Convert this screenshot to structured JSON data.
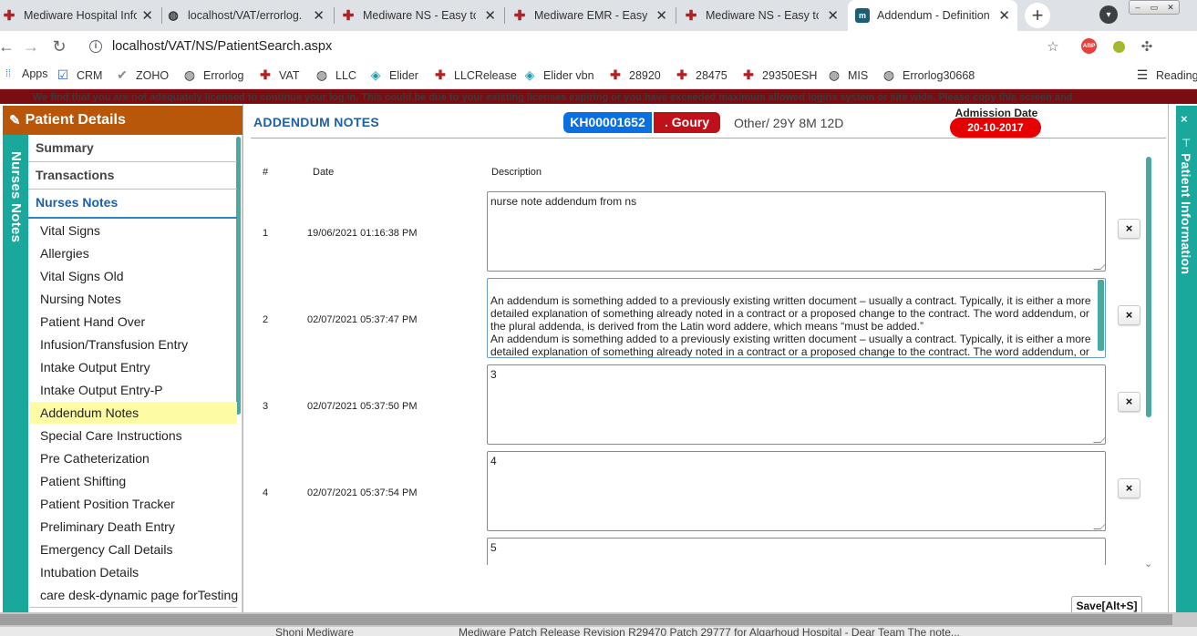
{
  "browser": {
    "tabs": [
      {
        "title": "Mediware Hospital Info",
        "icon": "mediware-cross-icon"
      },
      {
        "title": "localhost/VAT/errorlog.",
        "icon": "globe-icon"
      },
      {
        "title": "Mediware NS - Easy to",
        "icon": "mediware-cross-icon"
      },
      {
        "title": "Mediware EMR - Easy to",
        "icon": "mediware-cross-icon"
      },
      {
        "title": "Mediware NS - Easy to",
        "icon": "mediware-cross-icon"
      },
      {
        "title": "Addendum - Definition",
        "icon": "dictionary-icon",
        "active": true
      }
    ],
    "url": "localhost/VAT/NS/PatientSearch.aspx",
    "bookmarks": [
      {
        "label": "Apps",
        "icon": "apps-grid-icon"
      },
      {
        "label": "CRM",
        "icon": "checkbox-icon"
      },
      {
        "label": "ZOHO",
        "icon": "check-icon"
      },
      {
        "label": "Errorlog",
        "icon": "globe-icon"
      },
      {
        "label": "VAT",
        "icon": "mediware-cross-icon"
      },
      {
        "label": "LLC",
        "icon": "globe-icon"
      },
      {
        "label": "Elider",
        "icon": "diamond-icon"
      },
      {
        "label": "LLCRelease",
        "icon": "mediware-cross-icon"
      },
      {
        "label": "Elider vbn",
        "icon": "diamond-icon"
      },
      {
        "label": "28920",
        "icon": "mediware-cross-icon"
      },
      {
        "label": "28475",
        "icon": "mediware-cross-icon"
      },
      {
        "label": "29350ESH",
        "icon": "mediware-cross-icon"
      },
      {
        "label": "MIS",
        "icon": "globe-icon"
      },
      {
        "label": "Errorlog30668",
        "icon": "globe-icon"
      }
    ],
    "reading_list": "Reading",
    "license_banner": "We find that you are not adequately licensed to continue your log in. This could be due to your existing licenses expiring or you have exceeded maximum allowed logins system or site wide. Please copy this screen and"
  },
  "panel": {
    "header": "Patient Details",
    "rail_label": "Nurses Notes",
    "sections": [
      "Summary",
      "Transactions",
      "Nurses Notes"
    ],
    "active_section": "Nurses Notes",
    "items": [
      "Vital Signs",
      "Allergies",
      "Vital Signs Old",
      "Nursing Notes",
      "Patient Hand Over",
      "Infusion/Transfusion Entry",
      "Intake Output Entry",
      "Intake Output Entry-P",
      "Addendum Notes",
      "Special Care Instructions",
      "Pre Catheterization",
      "Patient Shifting",
      "Patient Position Tracker",
      "Preliminary Death Entry",
      "Emergency Call Details",
      "Intubation Details",
      "care desk-dynamic page forTesting"
    ],
    "selected_item": "Addendum Notes"
  },
  "main": {
    "title": "ADDENDUM NOTES",
    "patient_id": "KH00001652",
    "patient_name": ". Goury",
    "patient_info": "Other/ 29Y 8M 12D",
    "admission_label": "Admission Date",
    "admission_date": "20-10-2017",
    "columns": {
      "num": "#",
      "date": "Date",
      "desc": "Description"
    },
    "rows": [
      {
        "num": "1",
        "date": "19/06/2021 01:16:38 PM",
        "desc": "nurse note addendum from ns"
      },
      {
        "num": "2",
        "date": "02/07/2021 05:37:47 PM",
        "desc": "An addendum is something added to a previously existing written document – usually a contract. Typically, it is either a more detailed explanation of something already noted in a contract or a proposed change to the contract. The word addendum, or the plural addenda, is derived from the Latin word addere, which means “must be added.”\nAn addendum is something added to a previously existing written document – usually a contract. Typically, it is either a more detailed explanation of something already noted in a contract or a proposed change to the contract. The word addendum, or the plural addenda, is derived from the Latin word addere, which means “must be added.”"
      },
      {
        "num": "3",
        "date": "02/07/2021 05:37:50 PM",
        "desc": "3"
      },
      {
        "num": "4",
        "date": "02/07/2021 05:37:54 PM",
        "desc": "4"
      },
      {
        "num": "",
        "date": "",
        "desc": "5"
      }
    ],
    "delete_label": "×",
    "save_label": "Save[Alt+S]"
  },
  "right_rail": {
    "label": "Patient Information",
    "close": "×"
  },
  "taskbar": {
    "items": [
      "Shoni Mediware",
      "Mediware Patch Release Revision R29470 Patch 29777 for Algarhoud Hospital - Dear Team The note..."
    ]
  }
}
